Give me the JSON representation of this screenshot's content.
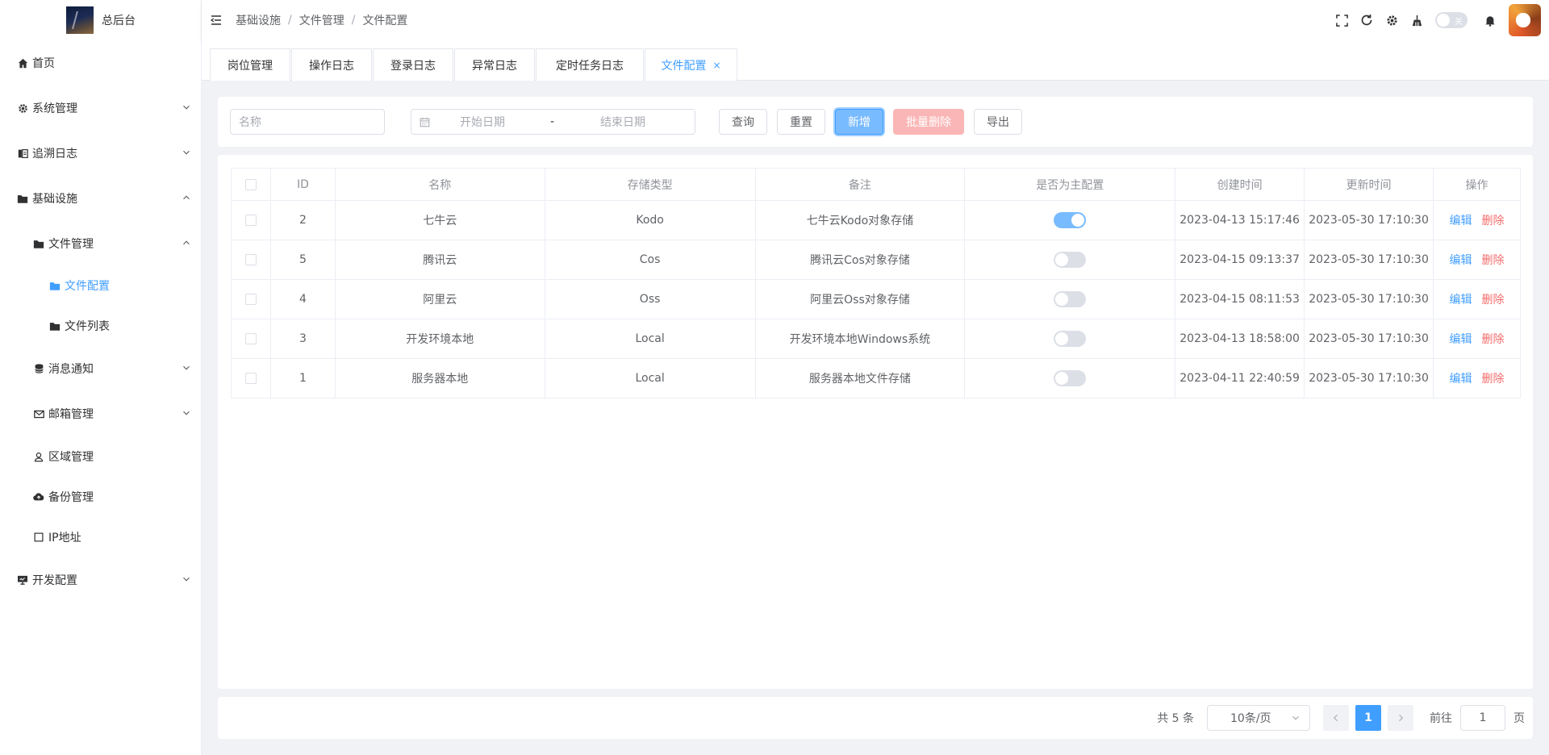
{
  "app": {
    "title": "总后台"
  },
  "sidebar": {
    "items": [
      {
        "label": "首页",
        "icon": "home-icon"
      },
      {
        "label": "系统管理",
        "icon": "gear-icon"
      },
      {
        "label": "追溯日志",
        "icon": "log-icon"
      },
      {
        "label": "基础设施",
        "icon": "folder-icon"
      },
      {
        "label": "文件管理",
        "icon": "folder-icon"
      },
      {
        "label": "文件配置",
        "icon": "folder-open-icon"
      },
      {
        "label": "文件列表",
        "icon": "folder-icon"
      },
      {
        "label": "消息通知",
        "icon": "database-icon"
      },
      {
        "label": "邮箱管理",
        "icon": "mail-icon"
      },
      {
        "label": "区域管理",
        "icon": "user-pin-icon"
      },
      {
        "label": "备份管理",
        "icon": "cloud-upload-icon"
      },
      {
        "label": "IP地址",
        "icon": "square-icon"
      },
      {
        "label": "开发配置",
        "icon": "monitor-icon"
      }
    ]
  },
  "header": {
    "breadcrumb": [
      "基础设施",
      "文件管理",
      "文件配置"
    ],
    "theme_switch_label": "关"
  },
  "tags": [
    {
      "label": "岗位管理"
    },
    {
      "label": "操作日志"
    },
    {
      "label": "登录日志"
    },
    {
      "label": "异常日志"
    },
    {
      "label": "定时任务日志"
    },
    {
      "label": "文件配置",
      "close": "×"
    }
  ],
  "search": {
    "name_placeholder": "名称",
    "date_start_placeholder": "开始日期",
    "date_sep": "-",
    "date_end_placeholder": "结束日期",
    "query_label": "查询",
    "reset_label": "重置",
    "add_label": "新增",
    "batch_delete_label": "批量删除",
    "export_label": "导出"
  },
  "table": {
    "headers": [
      "ID",
      "名称",
      "存储类型",
      "备注",
      "是否为主配置",
      "创建时间",
      "更新时间",
      "操作"
    ],
    "rows": [
      {
        "id": "2",
        "name": "七牛云",
        "type": "Kodo",
        "remark": "七牛云Kodo对象存储",
        "master": true,
        "created": "2023-04-13 15:17:46",
        "updated": "2023-05-30 17:10:30"
      },
      {
        "id": "5",
        "name": "腾讯云",
        "type": "Cos",
        "remark": "腾讯云Cos对象存储",
        "master": false,
        "created": "2023-04-15 09:13:37",
        "updated": "2023-05-30 17:10:30"
      },
      {
        "id": "4",
        "name": "阿里云",
        "type": "Oss",
        "remark": "阿里云Oss对象存储",
        "master": false,
        "created": "2023-04-15 08:11:53",
        "updated": "2023-05-30 17:10:30"
      },
      {
        "id": "3",
        "name": "开发环境本地",
        "type": "Local",
        "remark": "开发环境本地Windows系统",
        "master": false,
        "created": "2023-04-13 18:58:00",
        "updated": "2023-05-30 17:10:30"
      },
      {
        "id": "1",
        "name": "服务器本地",
        "type": "Local",
        "remark": "服务器本地文件存储",
        "master": false,
        "created": "2023-04-11 22:40:59",
        "updated": "2023-05-30 17:10:30"
      }
    ],
    "edit_label": "编辑",
    "delete_label": "删除"
  },
  "pagination": {
    "total_text": "共 5 条",
    "page_size": "10条/页",
    "current_page": "1",
    "goto_label": "前往",
    "goto_value": "1",
    "page_suffix": "页"
  },
  "colors": {
    "primary": "#409eff",
    "danger": "#f56c6c",
    "background": "#f0f2f5"
  }
}
